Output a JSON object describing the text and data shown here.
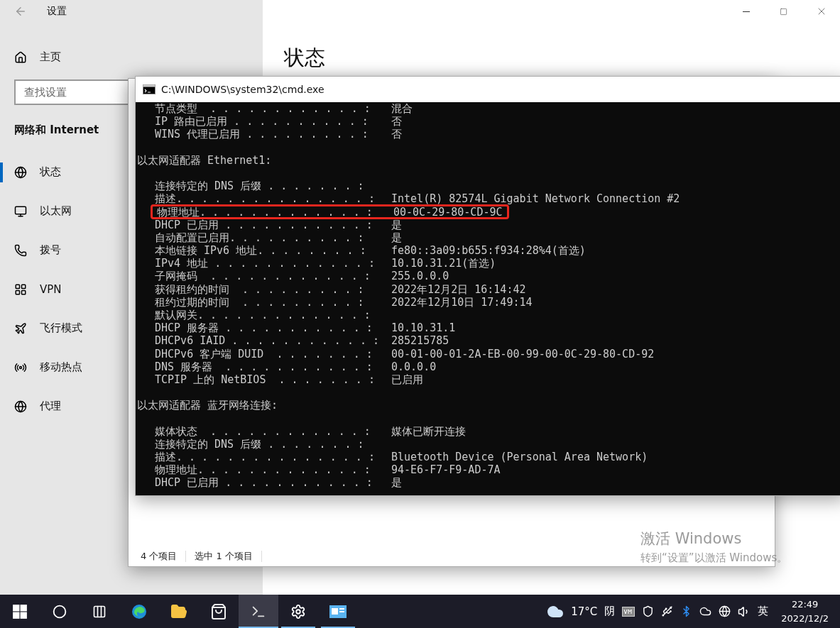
{
  "settings": {
    "title": "设置",
    "home": "主页",
    "search_placeholder": "查找设置",
    "section": "网络和 Internet",
    "page_title": "状态",
    "nav": [
      {
        "kind": "status",
        "label": "状态",
        "selected": true
      },
      {
        "kind": "ethernet",
        "label": "以太网",
        "selected": false
      },
      {
        "kind": "dialup",
        "label": "拨号",
        "selected": false
      },
      {
        "kind": "vpn",
        "label": "VPN",
        "selected": false
      },
      {
        "kind": "airplane",
        "label": "飞行模式",
        "selected": false
      },
      {
        "kind": "hotspot",
        "label": "移动热点",
        "selected": false
      },
      {
        "kind": "proxy",
        "label": "代理",
        "selected": false
      }
    ]
  },
  "explorer": {
    "status": [
      "4 个项目",
      "选中 1 个项目"
    ]
  },
  "cmd": {
    "title": "C:\\WINDOWS\\system32\\cmd.exe",
    "lines": [
      {
        "kind": "entry",
        "label": "节点类型  . . . . . . . . . . . . :",
        "value": "混合"
      },
      {
        "kind": "entry",
        "label": "IP 路由已启用 . . . . . . . . . . :",
        "value": "否"
      },
      {
        "kind": "entry",
        "label": "WINS 代理已启用 . . . . . . . . . :",
        "value": "否"
      },
      {
        "kind": "blank"
      },
      {
        "kind": "header",
        "label": "以太网适配器 Ethernet1:"
      },
      {
        "kind": "blank"
      },
      {
        "kind": "entry",
        "label": "连接特定的 DNS 后缀 . . . . . . . :"
      },
      {
        "kind": "entry",
        "label": "描述. . . . . . . . . . . . . . . :",
        "value": "Intel(R) 82574L Gigabit Network Connection #2"
      },
      {
        "kind": "entry",
        "label": "物理地址. . . . . . . . . . . . . :",
        "value": "00-0C-29-80-CD-9C",
        "highlighted": true
      },
      {
        "kind": "entry",
        "label": "DHCP 已启用 . . . . . . . . . . . :",
        "value": "是"
      },
      {
        "kind": "entry",
        "label": "自动配置已启用. . . . . . . . . . :",
        "value": "是"
      },
      {
        "kind": "entry",
        "label": "本地链接 IPv6 地址. . . . . . . . :",
        "value": "fe80::3a09:b655:f934:28%4(首选)"
      },
      {
        "kind": "entry",
        "label": "IPv4 地址 . . . . . . . . . . . . :",
        "value": "10.10.31.21(首选)"
      },
      {
        "kind": "entry",
        "label": "子网掩码  . . . . . . . . . . . . :",
        "value": "255.0.0.0"
      },
      {
        "kind": "entry",
        "label": "获得租约的时间  . . . . . . . . . :",
        "value": "2022年12月2日 16:14:42"
      },
      {
        "kind": "entry",
        "label": "租约过期的时间  . . . . . . . . . :",
        "value": "2022年12月10日 17:49:14"
      },
      {
        "kind": "entry",
        "label": "默认网关. . . . . . . . . . . . . :"
      },
      {
        "kind": "entry",
        "label": "DHCP 服务器 . . . . . . . . . . . :",
        "value": "10.10.31.1"
      },
      {
        "kind": "entry",
        "label": "DHCPv6 IAID . . . . . . . . . . . :",
        "value": "285215785"
      },
      {
        "kind": "entry",
        "label": "DHCPv6 客户端 DUID  . . . . . . . :",
        "value": "00-01-00-01-2A-EB-00-99-00-0C-29-80-CD-92"
      },
      {
        "kind": "entry",
        "label": "DNS 服务器  . . . . . . . . . . . :",
        "value": "0.0.0.0"
      },
      {
        "kind": "entry",
        "label": "TCPIP 上的 NetBIOS  . . . . . . . :",
        "value": "已启用"
      },
      {
        "kind": "blank"
      },
      {
        "kind": "header",
        "label": "以太网适配器 蓝牙网络连接:"
      },
      {
        "kind": "blank"
      },
      {
        "kind": "entry",
        "label": "媒体状态  . . . . . . . . . . . . :",
        "value": "媒体已断开连接"
      },
      {
        "kind": "entry",
        "label": "连接特定的 DNS 后缀 . . . . . . . :"
      },
      {
        "kind": "entry",
        "label": "描述. . . . . . . . . . . . . . . :",
        "value": "Bluetooth Device (Personal Area Network)"
      },
      {
        "kind": "entry",
        "label": "物理地址. . . . . . . . . . . . . :",
        "value": "94-E6-F7-F9-AD-7A"
      },
      {
        "kind": "entry",
        "label": "DHCP 已启用 . . . . . . . . . . . :",
        "value": "是"
      }
    ]
  },
  "activation": {
    "title": "激活 Windows",
    "hint": "转到“设置”以激活 Windows。"
  },
  "taskbar": {
    "apps": [
      {
        "kind": "start",
        "running": false,
        "selected": false
      },
      {
        "kind": "search",
        "running": false,
        "selected": false
      },
      {
        "kind": "taskview",
        "running": false,
        "selected": false
      },
      {
        "kind": "edge",
        "running": false,
        "selected": false
      },
      {
        "kind": "explorer",
        "running": false,
        "selected": false
      },
      {
        "kind": "store",
        "running": false,
        "selected": false
      },
      {
        "kind": "cmd",
        "running": true,
        "selected": true
      },
      {
        "kind": "settings",
        "running": true,
        "selected": false
      },
      {
        "kind": "app",
        "running": true,
        "selected": false
      }
    ],
    "weather": {
      "temp": "17°C",
      "condition": "阴"
    },
    "ime": "英",
    "time": "22:49",
    "date": "2022/12/2"
  }
}
